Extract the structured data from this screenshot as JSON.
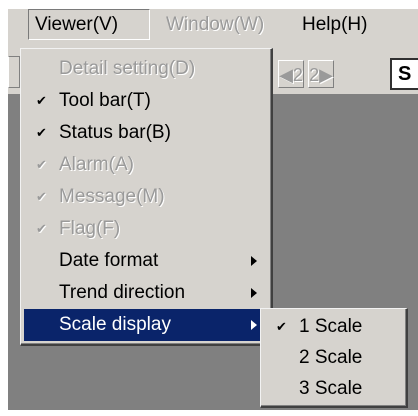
{
  "menubar": {
    "items": [
      {
        "label": "Viewer(V)",
        "state": "open"
      },
      {
        "label": "Window(W)",
        "state": "disabled"
      },
      {
        "label": "Help(H)",
        "state": "normal"
      }
    ]
  },
  "toolbar": {
    "buttons": [
      {
        "label": "◀2",
        "icon": "previous-2-icon"
      },
      {
        "label": "2▶",
        "icon": "next-2-icon"
      }
    ],
    "partial_label": "S"
  },
  "viewer_menu": {
    "items": [
      {
        "label": "Detail setting(D)",
        "checked": false,
        "disabled": true,
        "submenu": false
      },
      {
        "label": "Tool bar(T)",
        "checked": true,
        "disabled": false,
        "submenu": false
      },
      {
        "label": "Status bar(B)",
        "checked": true,
        "disabled": false,
        "submenu": false
      },
      {
        "label": "Alarm(A)",
        "checked": true,
        "disabled": true,
        "submenu": false
      },
      {
        "label": "Message(M)",
        "checked": true,
        "disabled": true,
        "submenu": false
      },
      {
        "label": "Flag(F)",
        "checked": true,
        "disabled": true,
        "submenu": false
      },
      {
        "label": "Date format",
        "checked": false,
        "disabled": false,
        "submenu": true
      },
      {
        "label": "Trend direction",
        "checked": false,
        "disabled": false,
        "submenu": true
      },
      {
        "label": "Scale display",
        "checked": false,
        "disabled": false,
        "submenu": true,
        "highlighted": true
      }
    ],
    "check_glyph": "✔"
  },
  "scale_submenu": {
    "items": [
      {
        "label": "1 Scale",
        "checked": true
      },
      {
        "label": "2 Scale",
        "checked": false
      },
      {
        "label": "3 Scale",
        "checked": false
      }
    ]
  },
  "colors": {
    "face": "#d6d3ce",
    "highlight": "#0a246a",
    "workspace": "#808080",
    "disabled_text": "#9a9a9a"
  }
}
